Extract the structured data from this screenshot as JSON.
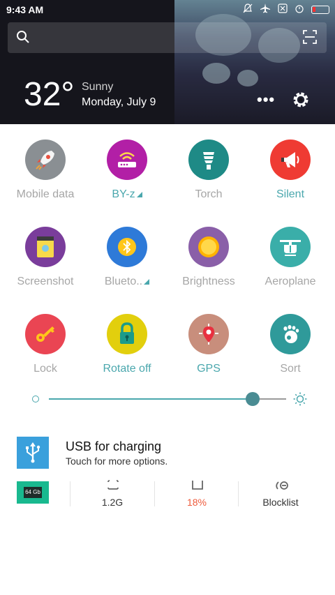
{
  "status_bar": {
    "time": "9:43 AM",
    "icons": [
      "silent-bell-icon",
      "airplane-icon",
      "sim-off-icon",
      "alarm-icon",
      "battery-low-icon"
    ]
  },
  "search": {
    "search_icon": "search-icon",
    "scan_icon": "scan-icon"
  },
  "weather": {
    "temperature": "32°",
    "condition": "Sunny",
    "date": "Monday, July 9"
  },
  "header_actions": {
    "more": "•••",
    "settings_icon": "gear-icon"
  },
  "toggles": [
    {
      "label": "Mobile data",
      "icon": "rocket-icon",
      "color": "#8a8f93",
      "active": false
    },
    {
      "label": "BY-z",
      "icon": "wifi-router-icon",
      "color": "#b21fa6",
      "active": true
    },
    {
      "label": "Torch",
      "icon": "bulb-icon",
      "color": "#1e8a86",
      "active": false
    },
    {
      "label": "Silent",
      "icon": "megaphone-icon",
      "color": "#ef3b33",
      "active": true
    },
    {
      "label": "Screenshot",
      "icon": "screenshot-icon",
      "color": "#7a3d9b",
      "active": false
    },
    {
      "label": "Blueto..",
      "icon": "bluetooth-icon",
      "color": "#2e7ad8",
      "active": false
    },
    {
      "label": "Brightness",
      "icon": "sun-icon",
      "color": "#8a5fa8",
      "active": false
    },
    {
      "label": "Aeroplane",
      "icon": "helicopter-icon",
      "color": "#3aaea9",
      "active": false
    },
    {
      "label": "Lock",
      "icon": "key-icon",
      "color": "#ea4553",
      "active": false
    },
    {
      "label": "Rotate off",
      "icon": "padlock-icon",
      "color": "#e2cf0d",
      "active": true
    },
    {
      "label": "GPS",
      "icon": "location-pin-icon",
      "color": "#c88e7c",
      "active": true
    },
    {
      "label": "Sort",
      "icon": "footprint-icon",
      "color": "#2f9a9a",
      "active": false
    }
  ],
  "brightness": {
    "level": 0.86
  },
  "notification": {
    "title": "USB for charging",
    "subtitle": "Touch for more options."
  },
  "tools": {
    "storage_badge": "64 Gb",
    "memory": "1.2G",
    "battery": "18%",
    "blocklist": "Blocklist"
  },
  "colors": {
    "accent": "#4aa7ad",
    "battery_warn": "#ee5a3b",
    "header_bg": "#15151c"
  }
}
